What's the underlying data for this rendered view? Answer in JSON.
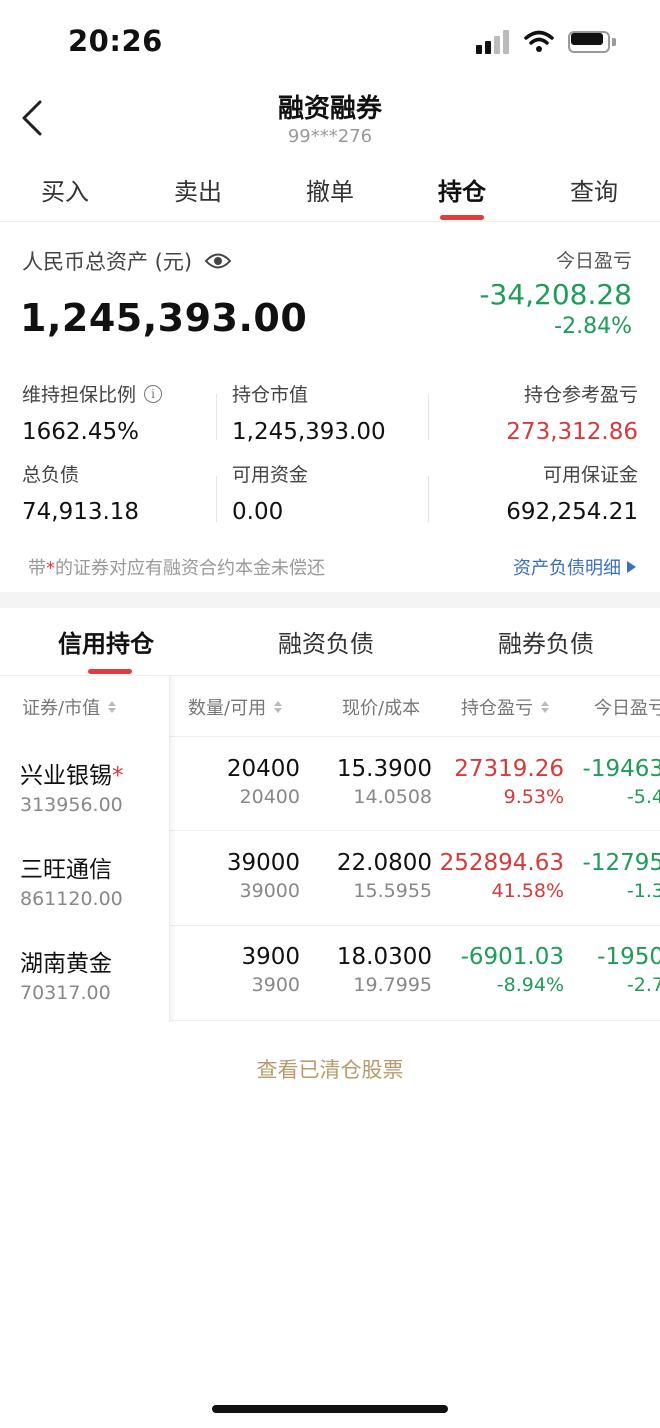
{
  "status_bar": {
    "time": "20:26"
  },
  "nav": {
    "title": "融资融券",
    "account": "99***276"
  },
  "trade_tabs": [
    {
      "label": "买入"
    },
    {
      "label": "卖出"
    },
    {
      "label": "撤单"
    },
    {
      "label": "持仓",
      "active": true
    },
    {
      "label": "查询"
    }
  ],
  "summary": {
    "total_label": "人民币总资产 (元)",
    "total_value": "1,245,393.00",
    "today_label": "今日盈亏",
    "today_value": "-34,208.28",
    "today_pct": "-2.84%",
    "metrics": {
      "maintain_ratio_label": "维持担保比例",
      "maintain_ratio_value": "1662.45%",
      "market_value_label": "持仓市值",
      "market_value_value": "1,245,393.00",
      "ref_pnl_label": "持仓参考盈亏",
      "ref_pnl_value": "273,312.86",
      "total_liability_label": "总负债",
      "total_liability_value": "74,913.18",
      "available_funds_label": "可用资金",
      "available_funds_value": "0.00",
      "available_margin_label": "可用保证金",
      "available_margin_value": "692,254.21"
    },
    "note_prefix": "带",
    "note_star": "*",
    "note_suffix": "的证券对应有融资合约本金未偿还",
    "detail_link": "资产负债明细"
  },
  "hold_tabs": [
    {
      "label": "信用持仓",
      "active": true
    },
    {
      "label": "融资负债"
    },
    {
      "label": "融券负债"
    }
  ],
  "table": {
    "headers": [
      "证券/市值",
      "数量/可用",
      "现价/成本",
      "持仓盈亏",
      "今日盈亏"
    ],
    "rows": [
      {
        "name": "兴业银锡",
        "star": "*",
        "market_value": "313956.00",
        "qty": "20400",
        "avail": "20400",
        "price": "15.3900",
        "cost": "14.0508",
        "pnl": "27319.26",
        "pnl_pct": "9.53%",
        "today": "-19463",
        "today_pct": "-5.4"
      },
      {
        "name": "三旺通信",
        "star": "",
        "market_value": "861120.00",
        "qty": "39000",
        "avail": "39000",
        "price": "22.0800",
        "cost": "15.5955",
        "pnl": "252894.63",
        "pnl_pct": "41.58%",
        "today": "-12795",
        "today_pct": "-1.3"
      },
      {
        "name": "湖南黄金",
        "star": "",
        "market_value": "70317.00",
        "qty": "3900",
        "avail": "3900",
        "price": "18.0300",
        "cost": "19.7995",
        "pnl": "-6901.03",
        "pnl_pct": "-8.94%",
        "today": "-1950",
        "today_pct": "-2.7"
      }
    ]
  },
  "view_cleared": "查看已清仓股票",
  "colors": {
    "accent_red": "#e23c3c",
    "profit_red": "#d63a3a",
    "loss_green": "#1f9b5a",
    "link_blue": "#3a6fbd",
    "gold": "#b89b6c"
  }
}
